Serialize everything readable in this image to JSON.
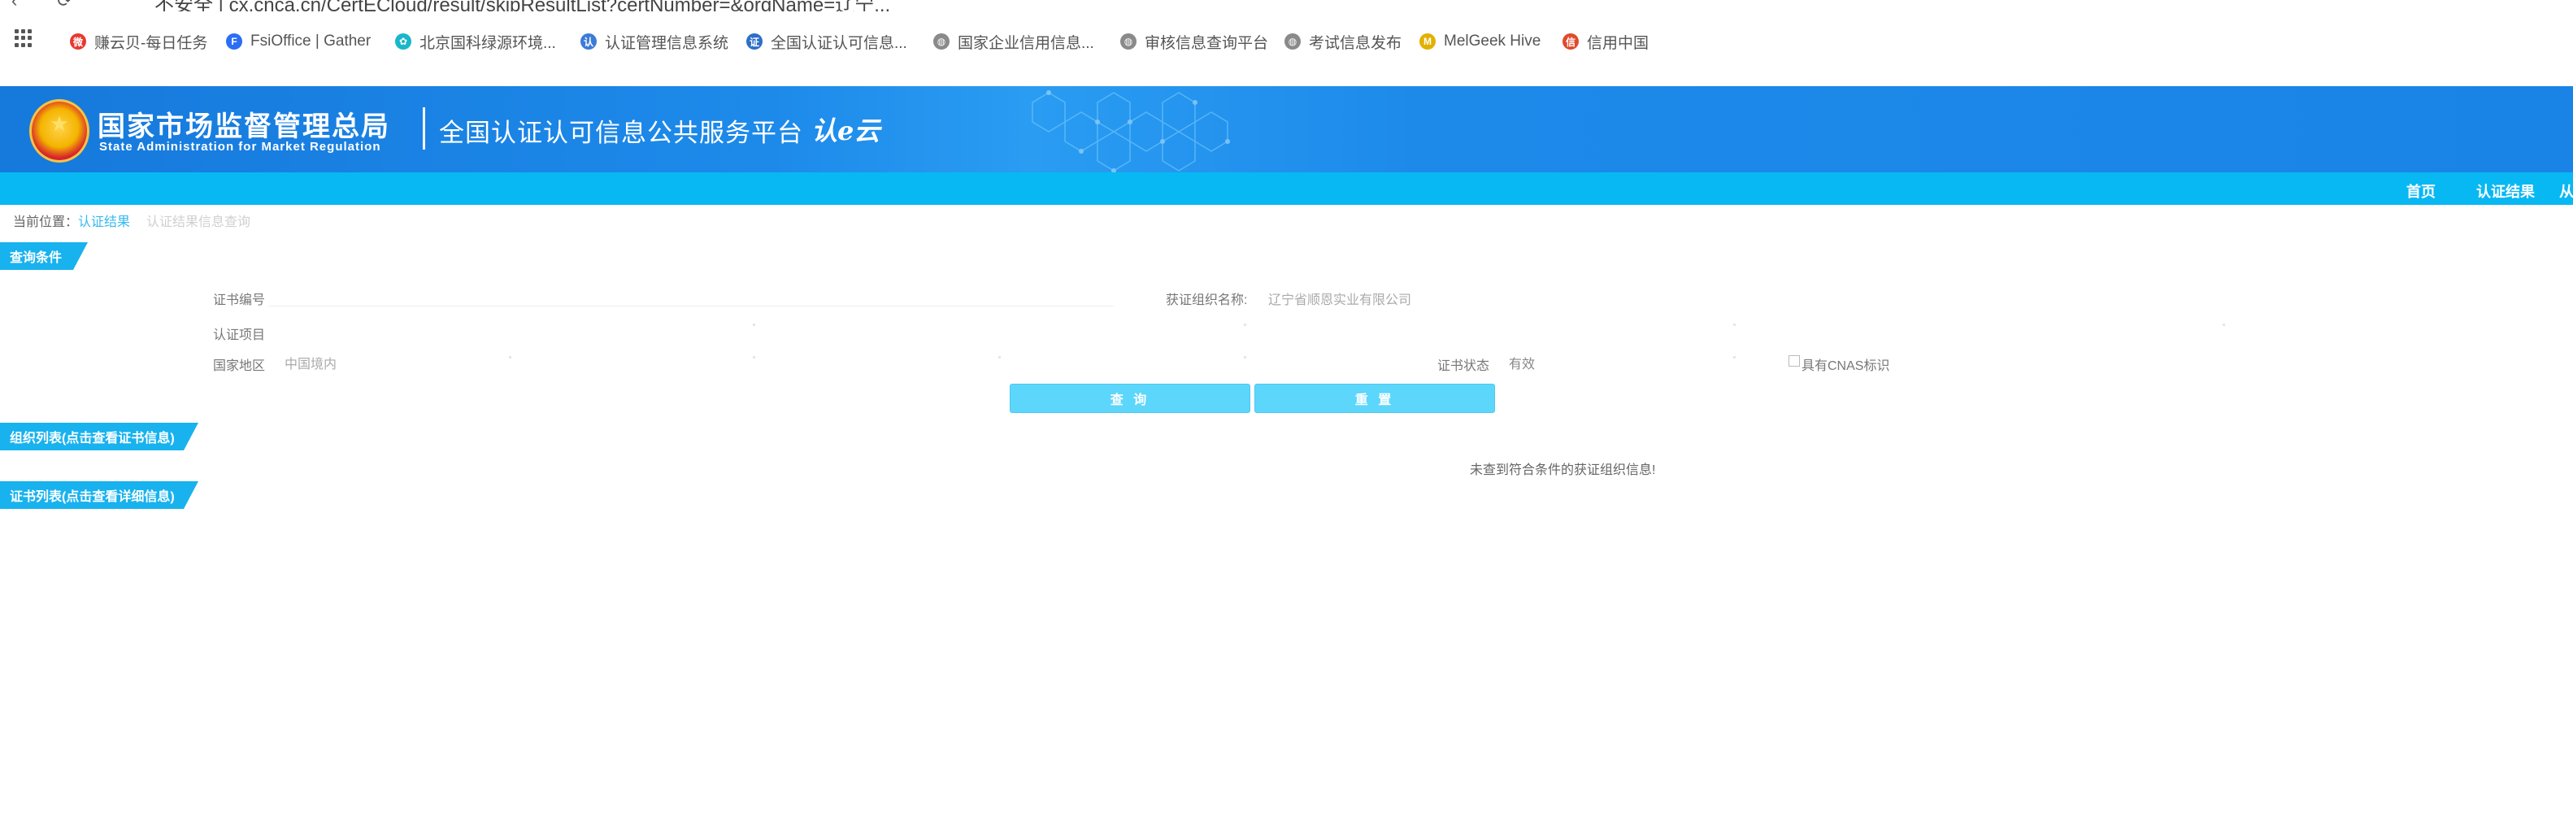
{
  "browser": {
    "url_text": "不安全 | cx.cnca.cn/CertECloud/result/skipResultList?certNumber=&orgName=辽宁..."
  },
  "bookmarks": [
    {
      "label": "赚云贝-每日任务",
      "icon": "weibo-icon",
      "color": "#e8382f"
    },
    {
      "label": "FsiOffice | Gather",
      "icon": "fsioffice-icon",
      "color": "#2b6ef5"
    },
    {
      "label": "北京国科绿源环境...",
      "icon": "leaf-icon",
      "color": "#18b7c9"
    },
    {
      "label": "认证管理信息系统",
      "icon": "cert-system-icon",
      "color": "#3b7bd8"
    },
    {
      "label": "全国认证认可信息...",
      "icon": "cert-platform-icon",
      "color": "#2d6ec9"
    },
    {
      "label": "国家企业信用信息...",
      "icon": "globe-icon",
      "color": "#8a8a8a"
    },
    {
      "label": "审核信息查询平台",
      "icon": "globe-icon",
      "color": "#8a8a8a"
    },
    {
      "label": "考试信息发布",
      "icon": "globe-icon",
      "color": "#8a8a8a"
    },
    {
      "label": "MelGeek Hive",
      "icon": "melgeek-icon",
      "color": "#e2b100"
    },
    {
      "label": "信用中国",
      "icon": "credit-china-icon",
      "color": "#e04a2c"
    }
  ],
  "header": {
    "agency_cn": "国家市场监督管理总局",
    "agency_en": "State Administration  for  Market Regulation",
    "platform_title": "全国认证认可信息公共服务平台",
    "logo_text": "认e云"
  },
  "nav": {
    "items": [
      "首页",
      "认证结果",
      "从"
    ]
  },
  "breadcrumb": {
    "prefix": "当前位置：",
    "current": "认证结果",
    "sub": "认证结果信息查询"
  },
  "sections": {
    "query": "查询条件",
    "org_list": "组织列表(点击查看证书信息)",
    "cert_list": "证书列表(点击查看详细信息)"
  },
  "form": {
    "cert_no_label": "证书编号",
    "org_name_label": "获证组织名称:",
    "org_name_value": "辽宁省顺恩实业有限公司",
    "cert_item_label": "认证项目",
    "region_label": "国家地区",
    "region_value": "中国境内",
    "status_label": "证书状态",
    "status_value": "有效",
    "cnas_label": "具有CNAS标识"
  },
  "buttons": {
    "search": "查 询",
    "reset": "重 置"
  },
  "results": {
    "empty_message": "未查到符合条件的获证组织信息!"
  }
}
